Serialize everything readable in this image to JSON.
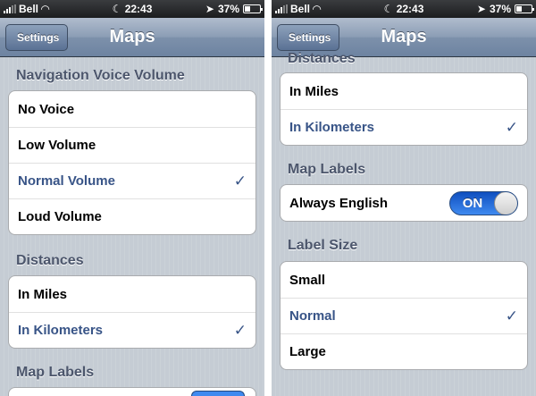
{
  "status": {
    "carrier": "Bell",
    "time": "22:43",
    "battery": "37%",
    "battery_level": 0.37
  },
  "nav": {
    "title": "Maps",
    "back_label": "Settings"
  },
  "left": {
    "voice_header": "Navigation Voice Volume",
    "voice_options": [
      "No Voice",
      "Low Volume",
      "Normal Volume",
      "Loud Volume"
    ],
    "voice_selected": "Normal Volume",
    "distances_header": "Distances",
    "distance_options": [
      "In Miles",
      "In Kilometers"
    ],
    "distance_selected": "In Kilometers",
    "map_labels_header": "Map Labels"
  },
  "right": {
    "distances_header": "Distances",
    "distance_options": [
      "In Miles",
      "In Kilometers"
    ],
    "distance_selected": "In Kilometers",
    "map_labels_header": "Map Labels",
    "always_english_label": "Always English",
    "always_english_toggle": "ON",
    "label_size_header": "Label Size",
    "label_size_options": [
      "Small",
      "Normal",
      "Large"
    ],
    "label_size_selected": "Normal"
  },
  "check_glyph": "✓",
  "colors": {
    "selected_text": "#385487",
    "navbar": "#6d83a1",
    "toggle_on": "#3f8af0"
  }
}
